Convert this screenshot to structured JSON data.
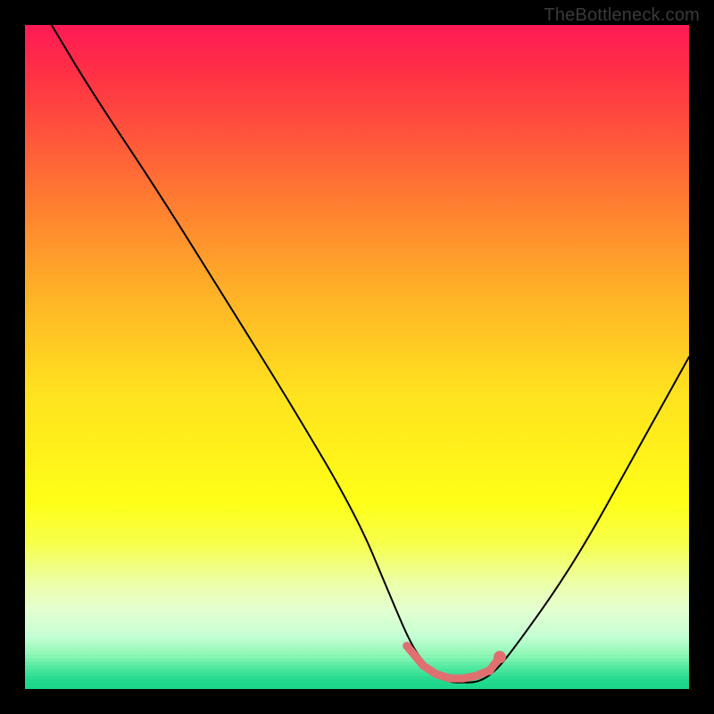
{
  "watermark": "TheBottleneck.com",
  "chart_data": {
    "type": "line",
    "title": "",
    "xlabel": "",
    "ylabel": "",
    "xlim": [
      0,
      100
    ],
    "ylim": [
      0,
      100
    ],
    "grid": false,
    "legend": false,
    "series": [
      {
        "name": "curve",
        "x": [
          4,
          10,
          20,
          30,
          40,
          50,
          55,
          58,
          60,
          62,
          64,
          66,
          68,
          70,
          72,
          75,
          80,
          85,
          90,
          95,
          100
        ],
        "values": [
          100,
          90,
          75,
          59,
          43,
          26,
          14,
          7,
          4,
          2,
          1,
          1,
          1,
          2,
          4,
          8,
          15,
          23,
          32,
          41,
          50
        ]
      }
    ],
    "markers": {
      "name": "bottom-dots",
      "x": [
        57.5,
        60,
        62,
        64,
        66,
        68,
        70,
        71.5
      ],
      "y": [
        6.5,
        3.5,
        2.2,
        1.6,
        1.6,
        2.0,
        2.8,
        4.8
      ],
      "size": [
        9,
        8,
        8,
        8,
        8,
        8,
        10,
        14
      ],
      "color": "#e07070"
    },
    "background": {
      "type": "vertical-gradient",
      "stops": [
        {
          "pos": 0.0,
          "color": "#ff1a55"
        },
        {
          "pos": 0.3,
          "color": "#ff8a2e"
        },
        {
          "pos": 0.6,
          "color": "#ffe81c"
        },
        {
          "pos": 0.85,
          "color": "#ecffb0"
        },
        {
          "pos": 1.0,
          "color": "#18d58a"
        }
      ]
    }
  }
}
